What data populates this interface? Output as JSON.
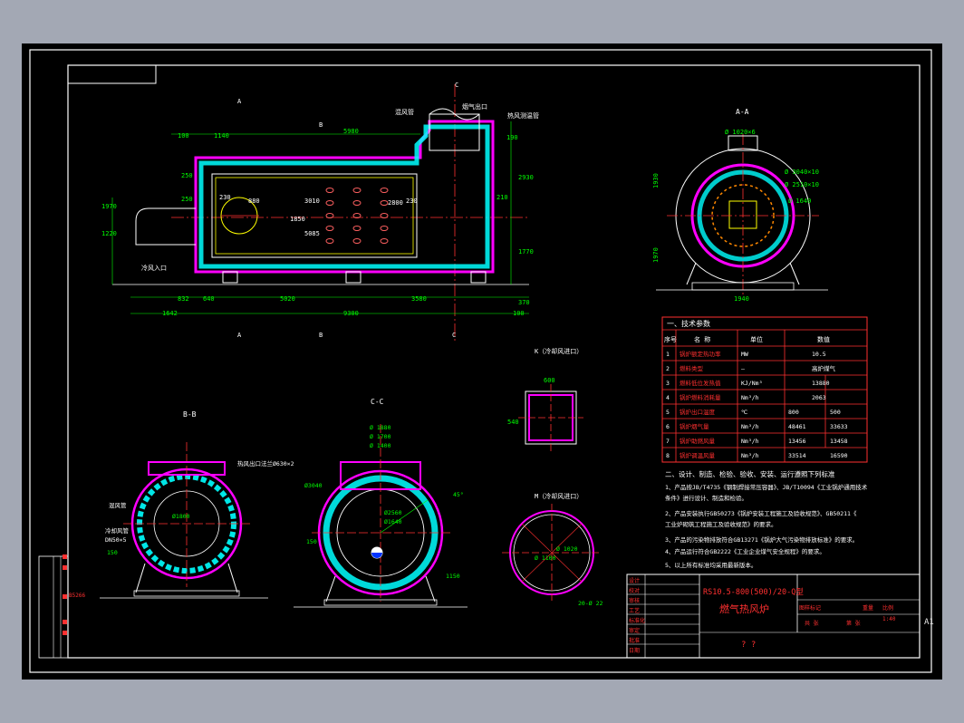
{
  "colors": {
    "background": "#a3a8b4",
    "canvas": "#000000",
    "frame": "#ffffff",
    "dimension": "#00ff00",
    "centerline": "#ff3030",
    "refractory": "#ff00ff",
    "insulation": "#00ffff",
    "text_red": "#ff3030"
  },
  "side_marker": "A1",
  "main_view": {
    "section_letters": [
      "A",
      "B",
      "C",
      "A",
      "B",
      "C"
    ],
    "dims_top": [
      "100",
      "1140",
      "5980",
      "190"
    ],
    "dims_left": [
      "1970",
      "1220",
      "250",
      "250"
    ],
    "dims_right": [
      "2930",
      "1770",
      "210",
      "370"
    ],
    "dims_bottom": [
      "832",
      "640",
      "5020",
      "3580",
      "1642",
      "9300",
      "100"
    ],
    "dims_inner": [
      "230",
      "880",
      "3010",
      "1850",
      "5085",
      "2800",
      "230"
    ],
    "callouts": {
      "bleed": "混风管",
      "flue": "烟气出口",
      "burner_pipe": "热风测温管",
      "cold_air": "冷风入口"
    }
  },
  "section_aa": {
    "title": "A-A",
    "dims": [
      "Ø 1020×6",
      "Ø 3040×10",
      "Ø 2510×10",
      "Ø 1640",
      "1930",
      "1970",
      "1940"
    ]
  },
  "section_bb": {
    "title": "B-B",
    "labels": [
      "热风出口法兰Ø630×2",
      "混风管",
      "冷却风管",
      "Ø1800",
      "DN50×5",
      "150"
    ]
  },
  "section_cc": {
    "title": "C-C",
    "dims": [
      "Ø 1880",
      "Ø 1700",
      "Ø 1400",
      "Ø3040",
      "Ø2560",
      "Ø1640",
      "150",
      "1150",
      "45°"
    ]
  },
  "section_k": {
    "title": "K（冷却风进口）",
    "dims": [
      "600",
      "540"
    ]
  },
  "section_m": {
    "title": "M（冷却风进口）",
    "dims": [
      "Ø 1100",
      "Ø 1020",
      "20-Ø 22"
    ]
  },
  "tech_table": {
    "title": "一、技术参数",
    "headers": [
      "序号",
      "名  称",
      "单位",
      "数值"
    ],
    "rows": [
      [
        "1",
        "锅炉额定热功率",
        "MW",
        "10.5",
        ""
      ],
      [
        "2",
        "燃料类型",
        "—",
        "高炉煤气",
        ""
      ],
      [
        "3",
        "燃料低位发热值",
        "KJ/Nm³",
        "13880",
        ""
      ],
      [
        "4",
        "锅炉燃料消耗量",
        "Nm³/h",
        "2063",
        ""
      ],
      [
        "5",
        "锅炉出口温度",
        "℃",
        "800",
        "500"
      ],
      [
        "6",
        "锅炉烟气量",
        "Nm³/h",
        "48461",
        "33633"
      ],
      [
        "7",
        "锅炉助燃风量",
        "Nm³/h",
        "13456",
        "13458"
      ],
      [
        "8",
        "锅炉调温风量",
        "Nm³/h",
        "33514",
        "16590"
      ]
    ]
  },
  "notes": {
    "title": "二、设计、制造、检验、验收、安装、运行遵照下列标准",
    "lines": [
      "1、产品按JB/T4735《钢制焊接常压容器》、JB/T10094《工业锅炉通用技术",
      "条件》进行设计、制造和检验。",
      "2、产品安装执行GB50273《锅炉安装工程施工及验收规范》、GB50211《",
      "工业炉砌筑工程施工及验收规范》的要求。",
      "3、产品的污染物排放符合GB13271《锅炉大气污染物排放标准》的要求。",
      "4、产品运行符合GB2222《工业企业煤气安全规程》的要求。",
      "5、以上所有标准均采用最新版本。"
    ]
  },
  "title_block": {
    "rows_left": [
      "设计",
      "校对",
      "审核",
      "工艺",
      "标准化",
      "审定",
      "批准",
      "日期"
    ],
    "drawing_no": "RS10.5-800(500)/20-Q型",
    "drawing_name": "燃气热风炉",
    "scale_label": "图样标记",
    "weight_label": "重量",
    "ratio_label": "比例",
    "ratio_value": "1:40",
    "sheet_label": "共 张",
    "sheet_label2": "第 张",
    "company": "? ?"
  },
  "left_strip": {
    "label": "B5266"
  }
}
